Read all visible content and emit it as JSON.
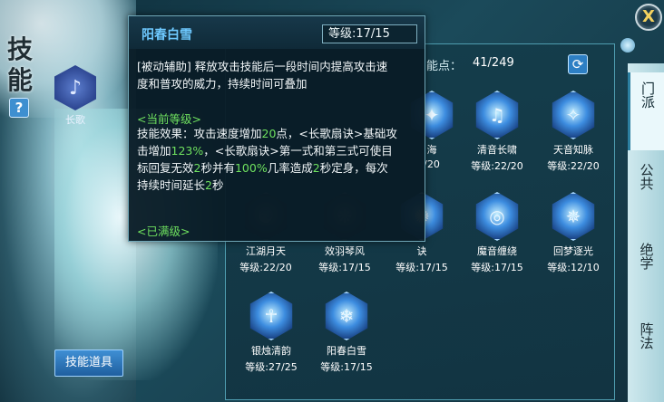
{
  "screen_title": "技能",
  "help_label": "?",
  "sect": {
    "label": "长歌"
  },
  "skill_item_button": "技能道具",
  "skill_points": {
    "label": "能点：",
    "value": "41/249"
  },
  "close_label": "X",
  "tabs": [
    {
      "label": "门派",
      "active": true
    },
    {
      "label": "公共",
      "active": false
    },
    {
      "label": "绝学",
      "active": false
    },
    {
      "label": "阵法",
      "active": false
    }
  ],
  "skills": [
    {
      "name": "海",
      "level": "/20",
      "row": 1
    },
    {
      "name": "清音长啸",
      "level": "等级:22/20",
      "row": 1
    },
    {
      "name": "天音知脉",
      "level": "等级:22/20",
      "row": 1
    },
    {
      "name": "江湖月天",
      "level": "等级:22/20",
      "row": 2
    },
    {
      "name": "效羽琴风",
      "level": "等级:17/15",
      "row": 2
    },
    {
      "name": "诀",
      "level": "等级:17/15",
      "row": 2
    },
    {
      "name": "魔音缠绕",
      "level": "等级:17/15",
      "row": 2
    },
    {
      "name": "回梦逐光",
      "level": "等级:12/10",
      "row": 2
    },
    {
      "name": "银烛清韵",
      "level": "等级:27/25",
      "row": 3
    },
    {
      "name": "阳春白雪",
      "level": "等级:17/15",
      "row": 3
    }
  ],
  "tooltip": {
    "skill_name": "阳春白雪",
    "level": "等级:17/15",
    "desc_line1": "[被动辅助]  释放攻击技能后一段时间内提高攻击速",
    "desc_line2": "度和普攻的威力，持续时间可叠加",
    "current_level_label": "<当前等级>",
    "effect": {
      "l1a": "技能效果：攻击速度增加",
      "v1": "20",
      "l1b": "点，<长歌扇诀>基础攻",
      "l2a": "击增加",
      "v2": "123%",
      "l2b": "，<长歌扇诀>第一式和第三式可使目",
      "l3a": "标回复无效",
      "v3": "2",
      "l3b": "秒并有",
      "v4": "100%",
      "l3c": "几率造成",
      "v5": "2",
      "l3d": "秒定身，每次",
      "l4a": "持续时间延长",
      "v6": "2",
      "l4b": "秒"
    },
    "maxed_label": "<已满级>"
  },
  "colors": {
    "accent": "#6ec9ff",
    "highlight": "#6fe15f",
    "panel": "#14404e"
  }
}
